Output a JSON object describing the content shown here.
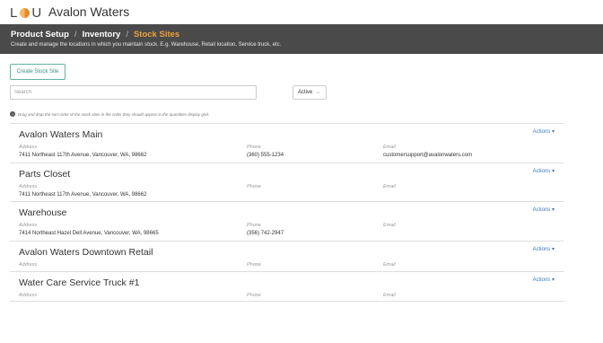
{
  "app": {
    "org_name": "Avalon Waters"
  },
  "breadcrumb": [
    "Product Setup",
    "Inventory",
    "Stock Sites"
  ],
  "page": {
    "subtitle": "Create and manage the locations in which you maintain stock. E.g. Warehouse, Retail location, Service truck, etc."
  },
  "toolbar": {
    "create_label": "Create Stock Site",
    "search_placeholder": "Search",
    "status_filter": "Active"
  },
  "hint": "Drag and drop the sort order of the stock sites in the order they should appear in the quantities display grid.",
  "labels": {
    "address": "Address",
    "phone": "Phone",
    "email": "Email",
    "actions": "Actions"
  },
  "sites": [
    {
      "name": "Avalon Waters Main",
      "address": "7411 Northeast 117th Avenue, Vancouver, WA, 98662",
      "phone": "(360) 555-1234",
      "email": "customersupport@avalonwaters.com"
    },
    {
      "name": "Parts Closet",
      "address": "7411 Northeast 117th Avenue, Vancouver, WA, 98662",
      "phone": "",
      "email": ""
    },
    {
      "name": "Warehouse",
      "address": "7414 Northeast Hazel Dell Avenue, Vancouver, WA, 98665",
      "phone": "(356) 742-2947",
      "email": ""
    },
    {
      "name": "Avalon Waters Downtown Retail",
      "address": "",
      "phone": "",
      "email": ""
    },
    {
      "name": "Water Care Service Truck #1",
      "address": "",
      "phone": "",
      "email": ""
    }
  ]
}
